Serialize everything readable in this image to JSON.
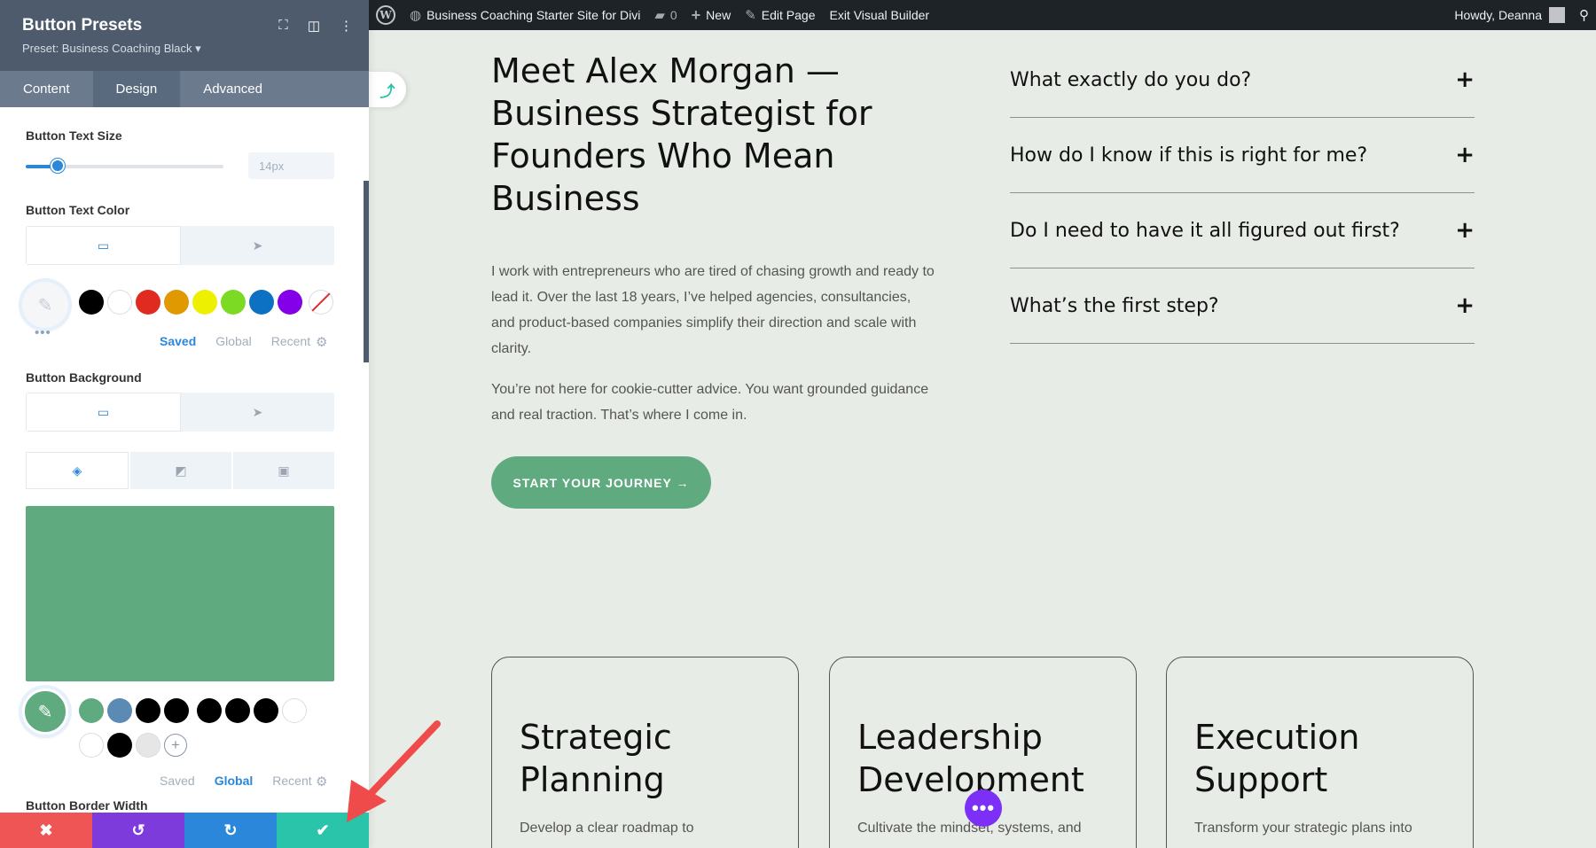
{
  "sidebar": {
    "title": "Button Presets",
    "preset": "Preset: Business Coaching Black ▾",
    "tabs": [
      "Content",
      "Design",
      "Advanced"
    ],
    "text_size_label": "Button Text Size",
    "text_size_value": "14px",
    "text_color_label": "Button Text Color",
    "background_label": "Button Background",
    "border_width_label": "Button Border Width",
    "palette_tabs_1": [
      "Saved",
      "Global",
      "Recent"
    ],
    "palette_tabs_2": [
      "Saved",
      "Global",
      "Recent"
    ],
    "text_color_swatches": [
      "#000000",
      "#ffffff",
      "#e02b20",
      "#e09900",
      "#edf000",
      "#7cda24",
      "#0c71c3",
      "#8300e9"
    ],
    "bg_swatches_row1": [
      "#5fab7f",
      "#5b8ab5",
      "#000000",
      "#000000",
      "#000000",
      "#000000",
      "#000000",
      "#ffffff"
    ],
    "bg_swatches_row2": [
      "#ffffff",
      "#000000",
      "#e6e6e6"
    ],
    "bg_color": "#5fab7f"
  },
  "admin_bar": {
    "site_name": "Business Coaching Starter Site for Divi",
    "comments": "0",
    "new": "New",
    "edit_page": "Edit Page",
    "exit": "Exit Visual Builder",
    "howdy": "Howdy, Deanna"
  },
  "hero": {
    "title": "Meet Alex Morgan — Business Strategist for Founders Who Mean Business",
    "p1": "I work with entrepreneurs who are tired of chasing growth and ready to lead it. Over the last 18 years, I’ve helped agencies, consultancies, and product-based companies simplify their direction and scale with clarity.",
    "p2": "You’re not here for cookie-cutter advice. You want grounded guidance and real traction. That’s where I come in.",
    "cta": "START YOUR JOURNEY →"
  },
  "faq": [
    "What exactly do you do?",
    "How do I know if this is right for me?",
    "Do I need to have it all figured out first?",
    "What’s the first step?"
  ],
  "cards": [
    {
      "title": "Strategic Planning",
      "text": "Develop a clear roadmap to"
    },
    {
      "title": "Leadership Development",
      "text": "Cultivate the mindset, systems, and"
    },
    {
      "title": "Execution Support",
      "text": "Transform your strategic plans into"
    }
  ],
  "colors": {
    "accent_green": "#5fab7f",
    "divi_blue": "#2b87da",
    "bar_red": "#ef5555",
    "bar_purple": "#7d3bdc",
    "bar_blue": "#2b87da",
    "bar_teal": "#29c4a9"
  }
}
